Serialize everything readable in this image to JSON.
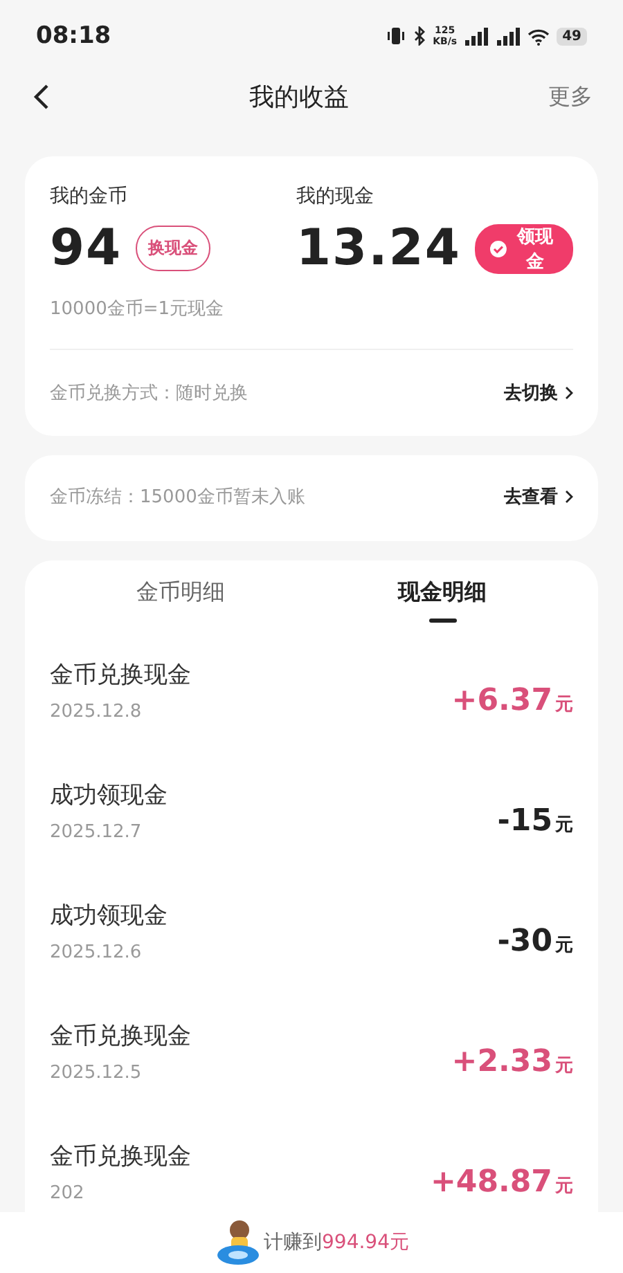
{
  "status_bar": {
    "time": "08:18",
    "network_speed": "125",
    "network_unit": "KB/s",
    "battery": "49"
  },
  "header": {
    "title": "我的收益",
    "more": "更多"
  },
  "summary": {
    "coins_label": "我的金币",
    "coins": "94",
    "coins_button": "换现金",
    "cash_label": "我的现金",
    "cash": "13.24",
    "cash_button": "领现金",
    "rate": "10000金币=1元现金",
    "method": "金币兑换方式：随时兑换",
    "method_action": "去切换"
  },
  "frozen": {
    "text": "金币冻结：15000金币暂未入账",
    "action": "去查看"
  },
  "tabs": [
    {
      "label": "金币明细",
      "selected": false
    },
    {
      "label": "现金明细",
      "selected": true
    }
  ],
  "records": [
    {
      "title": "金币兑换现金",
      "date": "2025.12.8",
      "amount": "+6.37",
      "unit": "元",
      "kind": "income"
    },
    {
      "title": "成功领现金",
      "date": "2025.12.7",
      "amount": "-15",
      "unit": "元",
      "kind": "expense"
    },
    {
      "title": "成功领现金",
      "date": "2025.12.6",
      "amount": "-30",
      "unit": "元",
      "kind": "expense"
    },
    {
      "title": "金币兑换现金",
      "date": "2025.12.5",
      "amount": "+2.33",
      "unit": "元",
      "kind": "income"
    },
    {
      "title": "金币兑换现金",
      "date": "202",
      "amount": "+48.87",
      "unit": "元",
      "kind": "income"
    }
  ],
  "footer": {
    "label": "计赚到",
    "total": "994.94元"
  }
}
